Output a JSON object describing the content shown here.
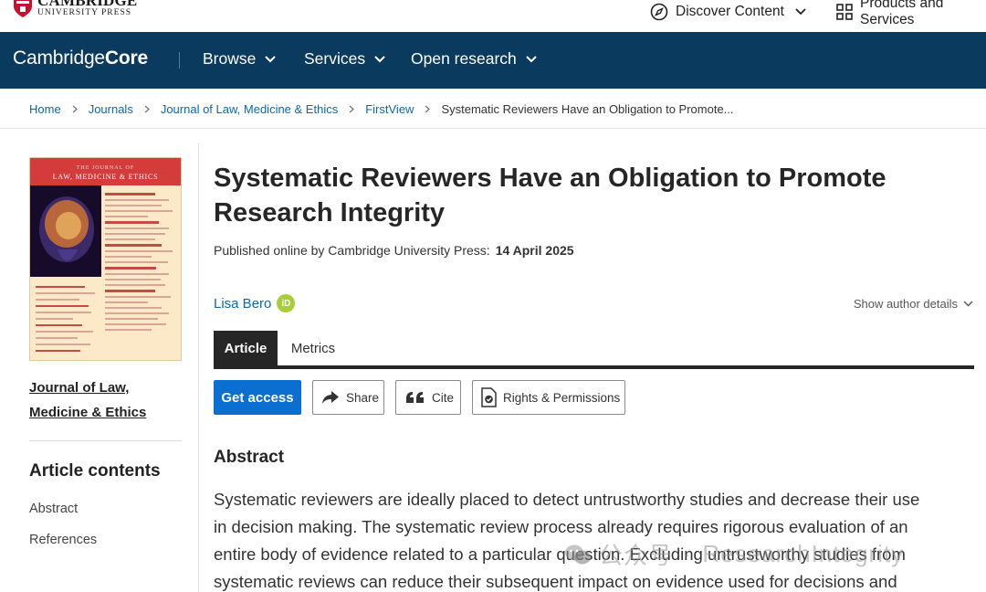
{
  "publisher_logo": {
    "line1": "CAMBRIDGE",
    "line2": "UNIVERSITY PRESS"
  },
  "utility": {
    "discover": "Discover Content",
    "products": "Products and Services"
  },
  "nav": {
    "brand_light": "Cambridge",
    "brand_bold": "Core",
    "items": [
      "Browse",
      "Services",
      "Open research"
    ]
  },
  "breadcrumb": [
    "Home",
    "Journals",
    "Journal of Law, Medicine & Ethics",
    "FirstView",
    "Systematic Reviewers Have an Obligation to Promote..."
  ],
  "cover": {
    "top_small": "THE JOURNAL OF",
    "top_title": "LAW, MEDICINE & ETHICS"
  },
  "journal": {
    "line1": "Journal of Law,",
    "line2": "Medicine & Ethics"
  },
  "contents": {
    "title": "Article contents",
    "items": [
      "Abstract",
      "References"
    ]
  },
  "article": {
    "title_line1": "Systematic Reviewers Have an Obligation to Promote",
    "title_line2": "Research Integrity",
    "published_label": "Published online by Cambridge University Press:",
    "published_date": "14 April 2025",
    "author": "Lisa Bero",
    "orcid_badge": "iD",
    "show_author": "Show author details"
  },
  "tabs": {
    "active": "Article",
    "inactive": "Metrics"
  },
  "actions": {
    "get_access": "Get access",
    "share": "Share",
    "cite": "Cite",
    "rights": "Rights & Permissions"
  },
  "abstract": {
    "title": "Abstract",
    "lines": [
      "Systematic reviewers are ideally placed to detect untrustworthy studies and decrease their use",
      "in decision making. The systematic review process already requires rigorous evaluation of an",
      "entire body of evidence related to a particular question. Excluding untrustworthy studies from",
      "systematic reviews can reduce their subsequent impact on evidence used for decisions and"
    ]
  },
  "watermark": {
    "left": "公众号",
    "sep": "·",
    "right": "ResearchIntegrity"
  },
  "colors": {
    "nav_bg": "#0b3a5f",
    "link": "#0a67b2",
    "primary_button": "#0a6fd1",
    "orcid": "#a6ce39"
  }
}
